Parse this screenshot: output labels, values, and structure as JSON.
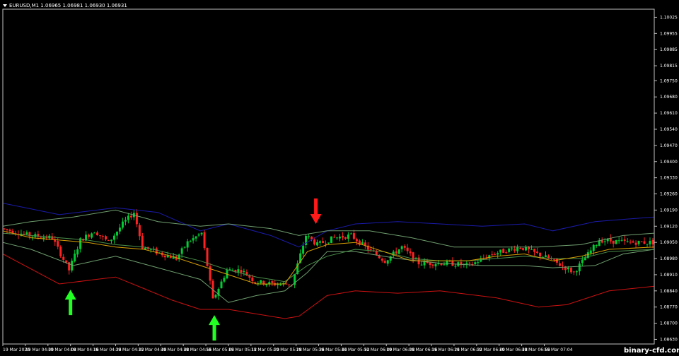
{
  "window": {
    "title": "EURUSD,M1  1.06965 1.06981 1.06930 1.06931",
    "watermark": "binary-cfd.com"
  },
  "colors": {
    "background": "#000000",
    "bull": "#00cc33",
    "bear": "#ff2222",
    "frame": "#c0c0c0",
    "bb_outer_upper": "#1a1aaa",
    "bb_outer_lower": "#cc1111",
    "bb_inner": "#6f9f6f",
    "ma_fast": "#d9a000",
    "ma_slow": "#4a8f4a",
    "arrow_up": "#22ff22",
    "arrow_down": "#ff1a1a"
  },
  "chart_data": {
    "type": "candlestick",
    "symbol": "EURUSD",
    "timeframe": "M1",
    "ylim": [
      1.0861,
      1.1006
    ],
    "xlim": [
      0,
      231
    ],
    "yticks": [
      "1.10025",
      "1.09955",
      "1.09885",
      "1.09815",
      "1.09750",
      "1.09680",
      "1.09610",
      "1.09540",
      "1.09470",
      "1.09400",
      "1.09330",
      "1.09260",
      "1.09190",
      "1.09120",
      "1.09050",
      "1.08980",
      "1.08910",
      "1.08840",
      "1.08770",
      "1.08700",
      "1.08630"
    ],
    "ytick_values": [
      1.10025,
      1.09955,
      1.09885,
      1.09815,
      1.0975,
      1.0968,
      1.0961,
      1.0954,
      1.0947,
      1.094,
      1.0933,
      1.0926,
      1.0919,
      1.0912,
      1.0905,
      1.0898,
      1.0891,
      1.0884,
      1.0877,
      1.087,
      1.0863
    ],
    "xticks": [
      "19 Mar 2020",
      "19 Mar 04:00",
      "19 Mar 04:08",
      "19 Mar 04:16",
      "19 Mar 04:24",
      "19 Mar 04:32",
      "19 Mar 04:40",
      "19 Mar 04:48",
      "19 Mar 04:56",
      "19 Mar 05:04",
      "19 Mar 05:12",
      "19 Mar 05:20",
      "19 Mar 05:28",
      "19 Mar 05:36",
      "19 Mar 05:44",
      "19 Mar 05:52",
      "19 Mar 06:00",
      "19 Mar 06:08",
      "19 Mar 06:16",
      "19 Mar 06:24",
      "19 Mar 06:32",
      "19 Mar 06:40",
      "19 Mar 06:48",
      "19 Mar 06:56",
      "19 Mar 07:04"
    ],
    "xtick_positions": [
      0,
      8,
      16,
      24,
      32,
      40,
      48,
      56,
      64,
      72,
      80,
      88,
      96,
      104,
      112,
      120,
      128,
      136,
      144,
      152,
      160,
      168,
      176,
      184,
      192
    ],
    "price_path": [
      [
        0,
        1.0911
      ],
      [
        10,
        1.0908
      ],
      [
        18,
        1.0907
      ],
      [
        24,
        1.0893
      ],
      [
        28,
        1.0906
      ],
      [
        33,
        1.091
      ],
      [
        38,
        1.0905
      ],
      [
        43,
        1.0913
      ],
      [
        47,
        1.0918
      ],
      [
        50,
        1.0903
      ],
      [
        57,
        1.09
      ],
      [
        62,
        1.0898
      ],
      [
        66,
        1.0905
      ],
      [
        71,
        1.0909
      ],
      [
        73,
        1.0895
      ],
      [
        75,
        1.088
      ],
      [
        80,
        1.0893
      ],
      [
        85,
        1.0893
      ],
      [
        90,
        1.0888
      ],
      [
        96,
        1.0887
      ],
      [
        103,
        1.0887
      ],
      [
        108,
        1.0908
      ],
      [
        112,
        1.0904
      ],
      [
        118,
        1.0907
      ],
      [
        124,
        1.0908
      ],
      [
        128,
        1.0904
      ],
      [
        136,
        1.0897
      ],
      [
        142,
        1.0903
      ],
      [
        148,
        1.0896
      ],
      [
        158,
        1.0896
      ],
      [
        166,
        1.0895
      ],
      [
        174,
        1.09
      ],
      [
        184,
        1.0903
      ],
      [
        194,
        1.0898
      ],
      [
        203,
        1.0892
      ],
      [
        212,
        1.0906
      ],
      [
        222,
        1.0905
      ],
      [
        231,
        1.0905
      ]
    ],
    "bands": {
      "outer_upper": [
        [
          0,
          1.0922
        ],
        [
          20,
          1.0917
        ],
        [
          40,
          1.092
        ],
        [
          55,
          1.0918
        ],
        [
          70,
          1.091
        ],
        [
          80,
          1.0913
        ],
        [
          95,
          1.0908
        ],
        [
          105,
          1.0903
        ],
        [
          115,
          1.091
        ],
        [
          125,
          1.0913
        ],
        [
          140,
          1.0914
        ],
        [
          155,
          1.0913
        ],
        [
          170,
          1.0912
        ],
        [
          185,
          1.0913
        ],
        [
          195,
          1.091
        ],
        [
          210,
          1.0914
        ],
        [
          231,
          1.0916
        ]
      ],
      "outer_lower": [
        [
          0,
          1.09
        ],
        [
          20,
          1.0887
        ],
        [
          40,
          1.089
        ],
        [
          50,
          1.0885
        ],
        [
          60,
          1.088
        ],
        [
          70,
          1.0876
        ],
        [
          80,
          1.0876
        ],
        [
          90,
          1.0874
        ],
        [
          100,
          1.0872
        ],
        [
          105,
          1.0873
        ],
        [
          115,
          1.0882
        ],
        [
          125,
          1.0884
        ],
        [
          140,
          1.0883
        ],
        [
          155,
          1.0884
        ],
        [
          175,
          1.0881
        ],
        [
          190,
          1.0877
        ],
        [
          200,
          1.0878
        ],
        [
          215,
          1.0884
        ],
        [
          231,
          1.0886
        ]
      ],
      "inner_upper": [
        [
          0,
          1.0912
        ],
        [
          10,
          1.0914
        ],
        [
          25,
          1.0916
        ],
        [
          40,
          1.0919
        ],
        [
          55,
          1.0914
        ],
        [
          70,
          1.0912
        ],
        [
          80,
          1.0913
        ],
        [
          95,
          1.0911
        ],
        [
          105,
          1.0908
        ],
        [
          115,
          1.091
        ],
        [
          130,
          1.091
        ],
        [
          145,
          1.0907
        ],
        [
          160,
          1.0903
        ],
        [
          175,
          1.0903
        ],
        [
          190,
          1.0903
        ],
        [
          205,
          1.0904
        ],
        [
          220,
          1.0908
        ],
        [
          231,
          1.0909
        ]
      ],
      "inner_lower": [
        [
          0,
          1.0905
        ],
        [
          10,
          1.0902
        ],
        [
          25,
          1.0895
        ],
        [
          40,
          1.0899
        ],
        [
          55,
          1.0894
        ],
        [
          70,
          1.0889
        ],
        [
          80,
          1.0879
        ],
        [
          90,
          1.0882
        ],
        [
          100,
          1.0884
        ],
        [
          108,
          1.0892
        ],
        [
          115,
          1.0901
        ],
        [
          125,
          1.0901
        ],
        [
          140,
          1.0898
        ],
        [
          155,
          1.0896
        ],
        [
          170,
          1.0895
        ],
        [
          185,
          1.0895
        ],
        [
          195,
          1.0894
        ],
        [
          210,
          1.0895
        ],
        [
          220,
          1.09
        ],
        [
          231,
          1.0902
        ]
      ]
    },
    "moving_averages": {
      "fast": [
        [
          0,
          1.091
        ],
        [
          10,
          1.0907
        ],
        [
          20,
          1.0906
        ],
        [
          30,
          1.0905
        ],
        [
          40,
          1.0903
        ],
        [
          50,
          1.0902
        ],
        [
          60,
          1.0899
        ],
        [
          70,
          1.0895
        ],
        [
          80,
          1.0891
        ],
        [
          90,
          1.0887
        ],
        [
          100,
          1.0887
        ],
        [
          108,
          1.0901
        ],
        [
          115,
          1.0904
        ],
        [
          125,
          1.0905
        ],
        [
          135,
          1.0901
        ],
        [
          145,
          1.0897
        ],
        [
          155,
          1.0897
        ],
        [
          165,
          1.0897
        ],
        [
          175,
          1.0899
        ],
        [
          185,
          1.09
        ],
        [
          195,
          1.0897
        ],
        [
          205,
          1.0899
        ],
        [
          215,
          1.0902
        ],
        [
          231,
          1.0903
        ]
      ],
      "slow": [
        [
          0,
          1.0909
        ],
        [
          10,
          1.0908
        ],
        [
          20,
          1.0907
        ],
        [
          30,
          1.0906
        ],
        [
          40,
          1.0904
        ],
        [
          50,
          1.0903
        ],
        [
          60,
          1.09
        ],
        [
          70,
          1.0897
        ],
        [
          80,
          1.0893
        ],
        [
          90,
          1.089
        ],
        [
          100,
          1.0888
        ],
        [
          108,
          1.0895
        ],
        [
          115,
          1.0899
        ],
        [
          125,
          1.0902
        ],
        [
          135,
          1.0901
        ],
        [
          145,
          1.0898
        ],
        [
          155,
          1.0897
        ],
        [
          165,
          1.0897
        ],
        [
          175,
          1.0898
        ],
        [
          185,
          1.0899
        ],
        [
          195,
          1.0898
        ],
        [
          205,
          1.0898
        ],
        [
          215,
          1.0901
        ],
        [
          231,
          1.0902
        ]
      ]
    },
    "signals": [
      {
        "type": "buy",
        "x": 24,
        "price": 1.08845
      },
      {
        "type": "buy",
        "x": 75,
        "price": 1.08735
      },
      {
        "type": "sell",
        "x": 111,
        "price": 1.0913
      }
    ]
  }
}
